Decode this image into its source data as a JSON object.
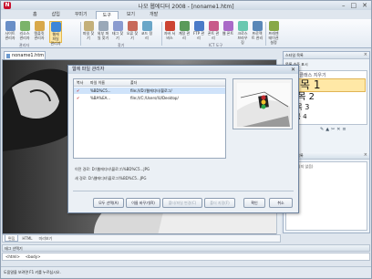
{
  "window": {
    "title": "나모 웹에디터 2008 - [noname1.htm]"
  },
  "ribbon": {
    "tabs": [
      "홈",
      "삽입",
      "꾸미기",
      "도구",
      "보기",
      "개발"
    ],
    "active_tab": "도구",
    "buttons": [
      {
        "label": "사이트 관리자",
        "color": "#6a8fc7"
      },
      {
        "label": "리소스 관리자",
        "color": "#7bb36a"
      },
      {
        "label": "템플릿 관리자",
        "color": "#d8a84a"
      },
      {
        "label": "웹에 파일 관리자",
        "color": "#3d86d8"
      },
      {
        "label": "파일 찾기",
        "color": "#c4b07a"
      },
      {
        "label": "외부 파일 찾기",
        "color": "#9aa8b8"
      },
      {
        "label": "태그 찾기",
        "color": "#8a9bd0"
      },
      {
        "label": "오류 찾기",
        "color": "#c86a5a"
      },
      {
        "label": "코드 정리",
        "color": "#6aa6c8"
      },
      {
        "label": "자바 서비스",
        "color": "#cc4433"
      },
      {
        "label": "계정 관리",
        "color": "#5a9a5a"
      },
      {
        "label": "FTP 관리",
        "color": "#4a7ac8"
      },
      {
        "label": "폰트 관리",
        "color": "#c85a8a"
      },
      {
        "label": "웹 폰트",
        "color": "#aa6ac8"
      },
      {
        "label": "크로스 브라우징",
        "color": "#6ac8b0"
      },
      {
        "label": "프로젝트 관리",
        "color": "#5a88b8"
      },
      {
        "label": "프레젠테이션 설정",
        "color": "#88a848"
      }
    ],
    "groups": [
      "관리자",
      "찾기",
      "ICT 도구"
    ]
  },
  "document": {
    "tab_label": "noname1.htm"
  },
  "editor_tabs": [
    "편집",
    "HTML",
    "미리보기"
  ],
  "dialog": {
    "title": "웹에 파일 관리자",
    "columns": [
      "복사",
      "파일 이름",
      "폴더"
    ],
    "rows": [
      {
        "check": "✔",
        "name": "%BD%C5...",
        "folder": "file:///D:/웹에디터/블로그/"
      },
      {
        "check": "✔",
        "name": "%BA%EA...",
        "folder": "file:///C:/Users/IU/Desktop/"
      }
    ],
    "source_label": "이전 경로: D:\\웹에디터\\블로그\\%BD%C5...JPG",
    "target_label": "새 경로: D:\\웹에디터\\블로그\\%BD%C5...JPG",
    "buttons": [
      "모두 선택(A)",
      "이름 바꾸기(R)",
      "폴더/파일 변경(C)",
      "폴더 지정(F)",
      "확인",
      "취소"
    ]
  },
  "style_panel": {
    "title": "스타일 목록",
    "subtitle": "목록 수준 표시",
    "clear_label": "CSS 클래스 지우기",
    "items": [
      "제목 1",
      "제목 2",
      "제목 3",
      "제목 4"
    ],
    "second_title": "스타일 목록",
    "empty_label": "(로드되지 않음)"
  },
  "tag_selector": {
    "title": "태그 선택기",
    "tags": [
      "<html>",
      "<body>"
    ]
  },
  "status": {
    "text": "도움말을 보려면 F1 키를 누르십시오."
  }
}
